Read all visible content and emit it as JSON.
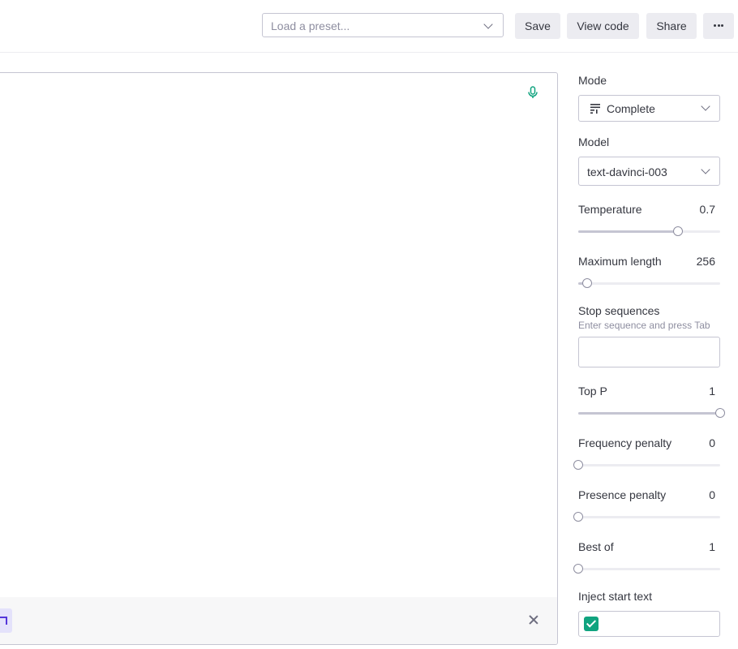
{
  "header": {
    "preset_placeholder": "Load a preset...",
    "save_label": "Save",
    "view_code_label": "View code",
    "share_label": "Share"
  },
  "icons": {
    "more": "ellipsis-icon",
    "mic": "microphone-icon",
    "close": "close-icon",
    "mode": "lines-icon",
    "external": "external-link-icon"
  },
  "colors": {
    "accent": "#10a37f",
    "ext_accent": "#5436da"
  },
  "settings": {
    "mode_label": "Mode",
    "mode_value": "Complete",
    "model_label": "Model",
    "model_value": "text-davinci-003",
    "temperature": {
      "label": "Temperature",
      "value": "0.7",
      "fraction": 0.7
    },
    "max_length": {
      "label": "Maximum length",
      "value": "256",
      "fraction": 0.062
    },
    "stop_sequences": {
      "label": "Stop sequences",
      "hint": "Enter sequence and press Tab"
    },
    "top_p": {
      "label": "Top P",
      "value": "1",
      "fraction": 1.0
    },
    "frequency_penalty": {
      "label": "Frequency penalty",
      "value": "0",
      "fraction": 0.0
    },
    "presence_penalty": {
      "label": "Presence penalty",
      "value": "0",
      "fraction": 0.0
    },
    "best_of": {
      "label": "Best of",
      "value": "1",
      "fraction": 0.0
    },
    "inject_start_text": {
      "label": "Inject start text",
      "checked": true
    }
  }
}
